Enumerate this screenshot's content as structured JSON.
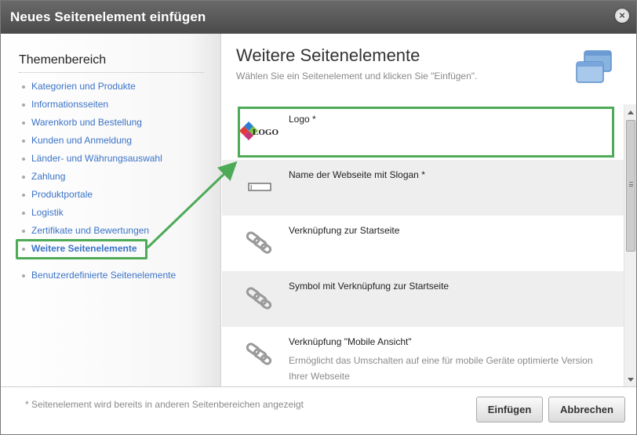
{
  "dialog": {
    "title": "Neues Seitenelement einfügen",
    "close_icon": "close-icon",
    "close_glyph": "×"
  },
  "sidebar": {
    "heading": "Themenbereich",
    "items": [
      {
        "label": "Kategorien und Produkte"
      },
      {
        "label": "Informationsseiten"
      },
      {
        "label": "Warenkorb und Bestellung"
      },
      {
        "label": "Kunden und Anmeldung"
      },
      {
        "label": "Länder- und Währungsauswahl"
      },
      {
        "label": "Zahlung"
      },
      {
        "label": "Produktportale"
      },
      {
        "label": "Logistik"
      },
      {
        "label": "Zertifikate und Bewertungen"
      },
      {
        "label": "Weitere Seitenelemente",
        "active": true
      },
      {
        "label": "Benutzerdefinierte Seitenelemente"
      }
    ]
  },
  "content": {
    "title": "Weitere Seitenelemente",
    "subtitle": "Wählen Sie ein Seitenelement und klicken Sie \"Einfügen\".",
    "header_icon": "windows-icon",
    "items": [
      {
        "name": "Logo *",
        "description": "",
        "icon": "logo-icon",
        "icon_text": "LOGO",
        "selected": true
      },
      {
        "name": "Name der Webseite mit Slogan *",
        "description": "",
        "icon": "text-field-icon",
        "icon_text": "I"
      },
      {
        "name": "Verknüpfung zur Startseite",
        "description": "",
        "icon": "chain-link-icon"
      },
      {
        "name": "Symbol mit Verknüpfung zur Startseite",
        "description": "",
        "icon": "chain-link-icon"
      },
      {
        "name": "Verknüpfung \"Mobile Ansicht\"",
        "description": "Ermöglicht das Umschalten auf eine für mobile Geräte optimierte Version Ihrer Webseite",
        "icon": "chain-link-icon"
      }
    ]
  },
  "footer": {
    "note": "* Seitenelement wird bereits in anderen Seitenbereichen angezeigt",
    "insert_label": "Einfügen",
    "cancel_label": "Abbrechen"
  },
  "colors": {
    "highlight": "#4daa57",
    "link": "#3b73c7",
    "titlebar": "#555555"
  }
}
